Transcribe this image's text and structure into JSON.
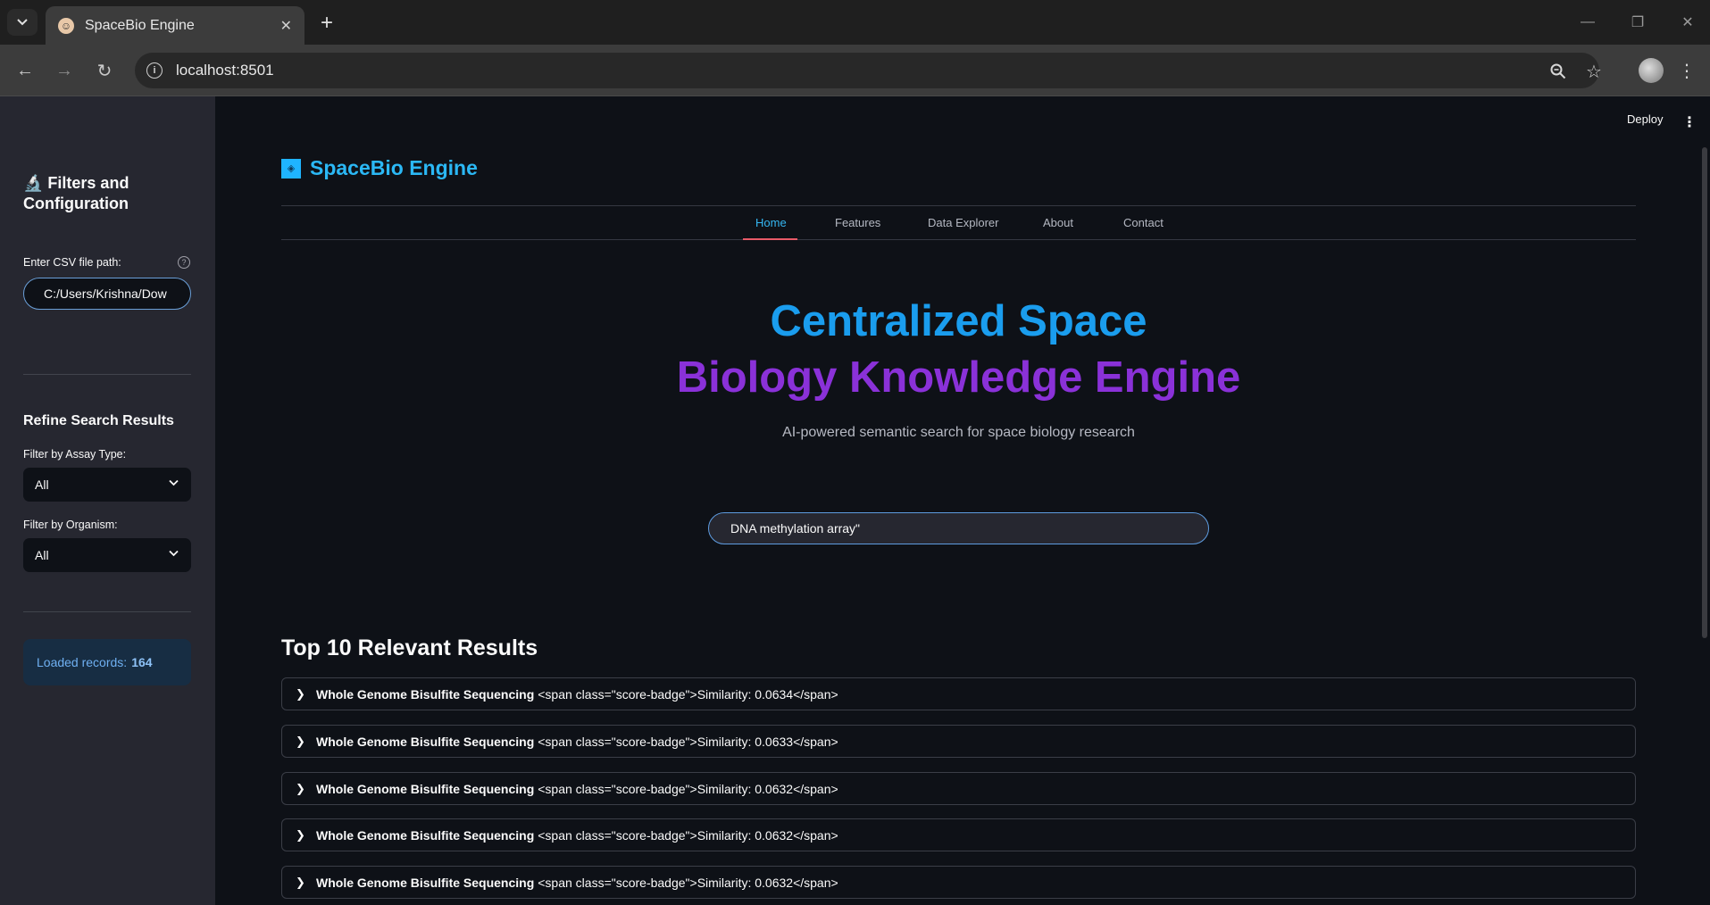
{
  "browser": {
    "tab_title": "SpaceBio Engine",
    "url": "localhost:8501"
  },
  "sidebar": {
    "title": "🔬 Filters and Configuration",
    "csv_label": "Enter CSV file path:",
    "csv_value": "C:/Users/Krishna/Dow",
    "refine_heading": "Refine Search Results",
    "assay_label": "Filter by Assay Type:",
    "assay_value": "All",
    "organism_label": "Filter by Organism:",
    "organism_value": "All",
    "loaded_label": "Loaded records:",
    "loaded_count": "164"
  },
  "header": {
    "deploy_label": "Deploy"
  },
  "brand": {
    "name": "SpaceBio Engine"
  },
  "nav": {
    "items": [
      "Home",
      "Features",
      "Data Explorer",
      "About",
      "Contact"
    ],
    "active": "Home"
  },
  "hero": {
    "line1": "Centralized Space",
    "line2": "Biology Knowledge Engine",
    "subtitle": "AI-powered semantic search for space biology research"
  },
  "search": {
    "value": "DNA methylation array\""
  },
  "results": {
    "title": "Top 10 Relevant Results",
    "items": [
      {
        "name": "Whole Genome Bisulfite Sequencing",
        "detail": "<span class=\"score-badge\">Similarity: 0.0634</span>"
      },
      {
        "name": "Whole Genome Bisulfite Sequencing",
        "detail": "<span class=\"score-badge\">Similarity: 0.0633</span>"
      },
      {
        "name": "Whole Genome Bisulfite Sequencing",
        "detail": "<span class=\"score-badge\">Similarity: 0.0632</span>"
      },
      {
        "name": "Whole Genome Bisulfite Sequencing",
        "detail": "<span class=\"score-badge\">Similarity: 0.0632</span>"
      },
      {
        "name": "Whole Genome Bisulfite Sequencing",
        "detail": "<span class=\"score-badge\">Similarity: 0.0632</span>"
      }
    ]
  }
}
